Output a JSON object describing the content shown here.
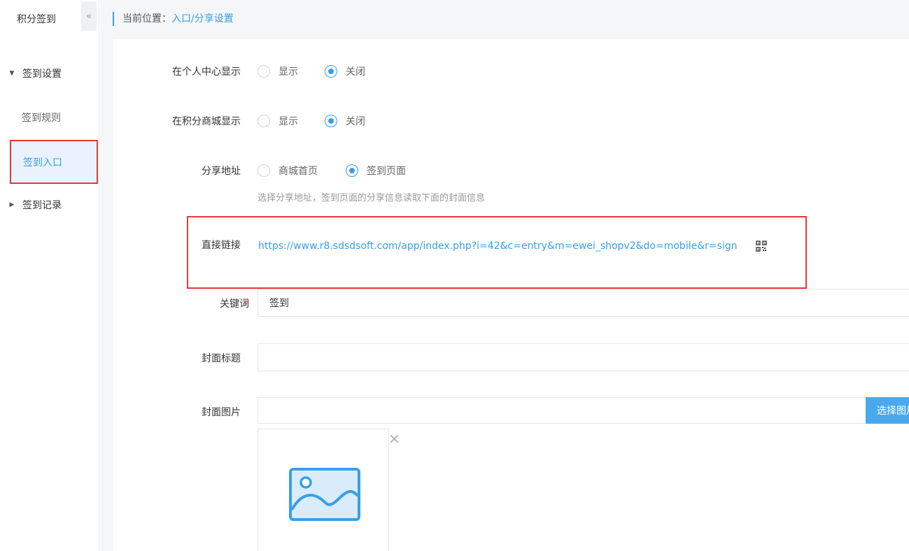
{
  "sidebar": {
    "title": "积分签到",
    "collapse_glyph": "«",
    "groups": [
      {
        "label": "签到设置",
        "caret": "▼"
      },
      {
        "label": "签到记录",
        "caret": "▶"
      }
    ],
    "items": [
      {
        "label": "签到规则"
      },
      {
        "label": "签到入口"
      }
    ]
  },
  "breadcrumb": {
    "prefix": "当前位置：",
    "path": "入口/分享设置"
  },
  "form": {
    "personal_center": {
      "label": "在个人中心显示",
      "options": [
        "显示",
        "关闭"
      ],
      "selected": "关闭"
    },
    "points_mall": {
      "label": "在积分商城显示",
      "options": [
        "显示",
        "关闭"
      ],
      "selected": "关闭"
    },
    "share_address": {
      "label": "分享地址",
      "options": [
        "商城首页",
        "签到页面"
      ],
      "selected": "签到页面",
      "help": "选择分享地址，签到页面的分享信息读取下面的封面信息"
    },
    "direct_link": {
      "label": "直接链接",
      "url": "https://www.r8.sdsdsoft.com/app/index.php?i=42&c=entry&m=ewei_shopv2&do=mobile&r=sign"
    },
    "keyword": {
      "label": "关键词",
      "required_mark": "*",
      "value": "签到"
    },
    "cover_title": {
      "label": "封面标题",
      "value": ""
    },
    "cover_image": {
      "label": "封面图片",
      "value": "",
      "button": "选择图片"
    }
  },
  "icons": {
    "qr": "qrcode-icon",
    "close": "close-icon",
    "image": "image-placeholder-icon"
  },
  "colors": {
    "accent": "#3a9ee8",
    "highlight": "#e23a3a",
    "button": "#4aa9ec"
  }
}
